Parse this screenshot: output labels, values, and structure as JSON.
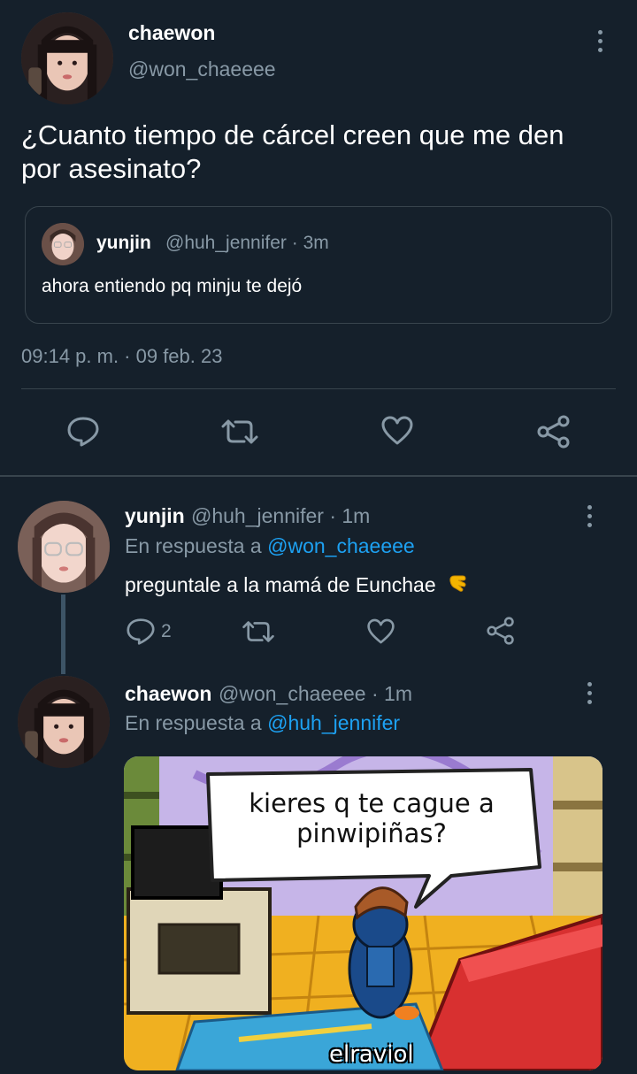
{
  "main_tweet": {
    "display_name": "chaewon",
    "handle": "@won_chaeeee",
    "text_line1": "¿Cuanto tiempo de cárcel creen que me den",
    "text_line2": "por asesinato?",
    "quoted": {
      "display_name": "yunjin",
      "handle_time": "@huh_jennifer · 3m",
      "text": "ahora entiendo pq minju te dejó"
    },
    "timestamp": "09:14 p. m. · 09 feb. 23"
  },
  "reply1": {
    "display_name": "yunjin",
    "handle_time": "@huh_jennifer · 1m",
    "reply_prefix": "En respuesta a",
    "reply_to": "@won_chaeeee",
    "text": "preguntale a la mamá de Eunchae",
    "emoji": "🫰",
    "reply_count": "2"
  },
  "reply2": {
    "display_name": "chaewon",
    "handle_time": "@won_chaeeee · 1m",
    "reply_prefix": "En respuesta a",
    "reply_to": "@huh_jennifer",
    "meme": {
      "caption_line1": "kieres q te cague a",
      "caption_line2": "pinwipiñas?",
      "watermark": "elraviol"
    }
  },
  "colors": {
    "background": "#15202b",
    "text": "#ffffff",
    "muted": "#8899a6",
    "link": "#1da1f2",
    "divider": "#38444d"
  }
}
